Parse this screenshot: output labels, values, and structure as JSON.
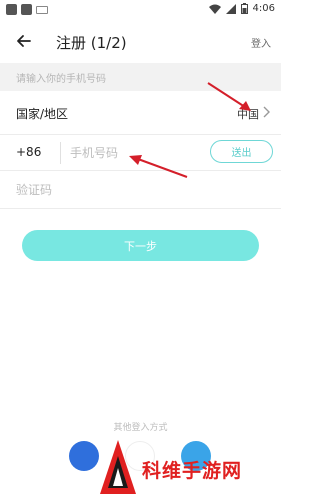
{
  "status_bar": {
    "time": "4:06"
  },
  "header": {
    "title": "注册 (1/2)",
    "login_label": "登入"
  },
  "hint": "请输入你的手机号码",
  "region": {
    "label": "国家/地区",
    "value": "中国"
  },
  "phone": {
    "country_code": "+86",
    "placeholder": "手机号码",
    "send_label": "送出"
  },
  "code": {
    "placeholder": "验证码"
  },
  "next_label": "下一步",
  "other_login_label": "其他登入方式",
  "watermark": {
    "text": "科维手游网"
  },
  "colors": {
    "accent": "#78e7e1",
    "annotation_arrow": "#d41f2a",
    "watermark": "#e02020"
  }
}
